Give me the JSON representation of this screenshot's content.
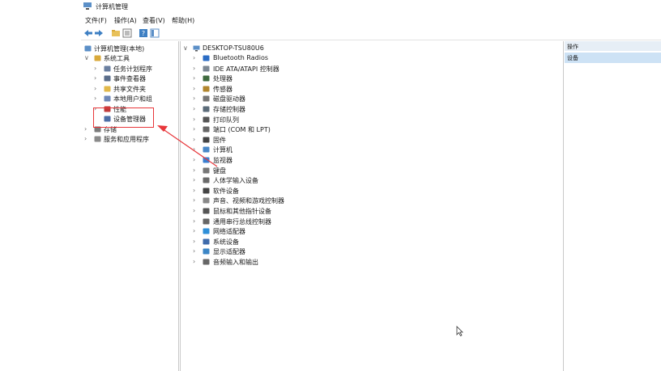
{
  "window": {
    "title": "计算机管理"
  },
  "menu": [
    "文件(F)",
    "操作(A)",
    "查看(V)",
    "帮助(H)"
  ],
  "toolbar": [
    "back-arrow-icon",
    "forward-arrow-icon",
    "up-folder-icon",
    "properties-icon",
    "help-icon",
    "show-hide-icon"
  ],
  "left_tree": [
    {
      "label": "计算机管理(本地)",
      "icon": "computer-management-icon",
      "chev": ""
    },
    {
      "label": "系统工具",
      "icon": "tools-icon",
      "chev": "∨"
    },
    {
      "label": "任务计划程序",
      "icon": "clock-icon",
      "chev": "›"
    },
    {
      "label": "事件查看器",
      "icon": "event-viewer-icon",
      "chev": "›"
    },
    {
      "label": "共享文件夹",
      "icon": "shared-folder-icon",
      "chev": "›"
    },
    {
      "label": "本地用户和组",
      "icon": "users-icon",
      "chev": "›"
    },
    {
      "label": "性能",
      "icon": "performance-icon",
      "chev": "›"
    },
    {
      "label": "设备管理器",
      "icon": "device-manager-icon",
      "chev": ""
    },
    {
      "label": "存储",
      "icon": "storage-icon",
      "chev": "›"
    },
    {
      "label": "服务和应用程序",
      "icon": "services-icon",
      "chev": "›"
    }
  ],
  "device_tree": {
    "root": "DESKTOP-TSU80U6",
    "categories": [
      "Bluetooth Radios",
      "IDE ATA/ATAPI 控制器",
      "处理器",
      "传感器",
      "磁盘驱动器",
      "存储控制器",
      "打印队列",
      "端口 (COM 和 LPT)",
      "固件",
      "计算机",
      "监视器",
      "键盘",
      "人体学输入设备",
      "软件设备",
      "声音、视频和游戏控制器",
      "鼠标和其他指针设备",
      "通用串行总线控制器",
      "网络适配器",
      "系统设备",
      "显示适配器",
      "音频输入和输出"
    ]
  },
  "actions": {
    "header": "操作",
    "selected": "设备"
  },
  "colors": {
    "highlight": "#e8373b",
    "selection": "#cde2f5",
    "action_header": "#e6eef6"
  }
}
